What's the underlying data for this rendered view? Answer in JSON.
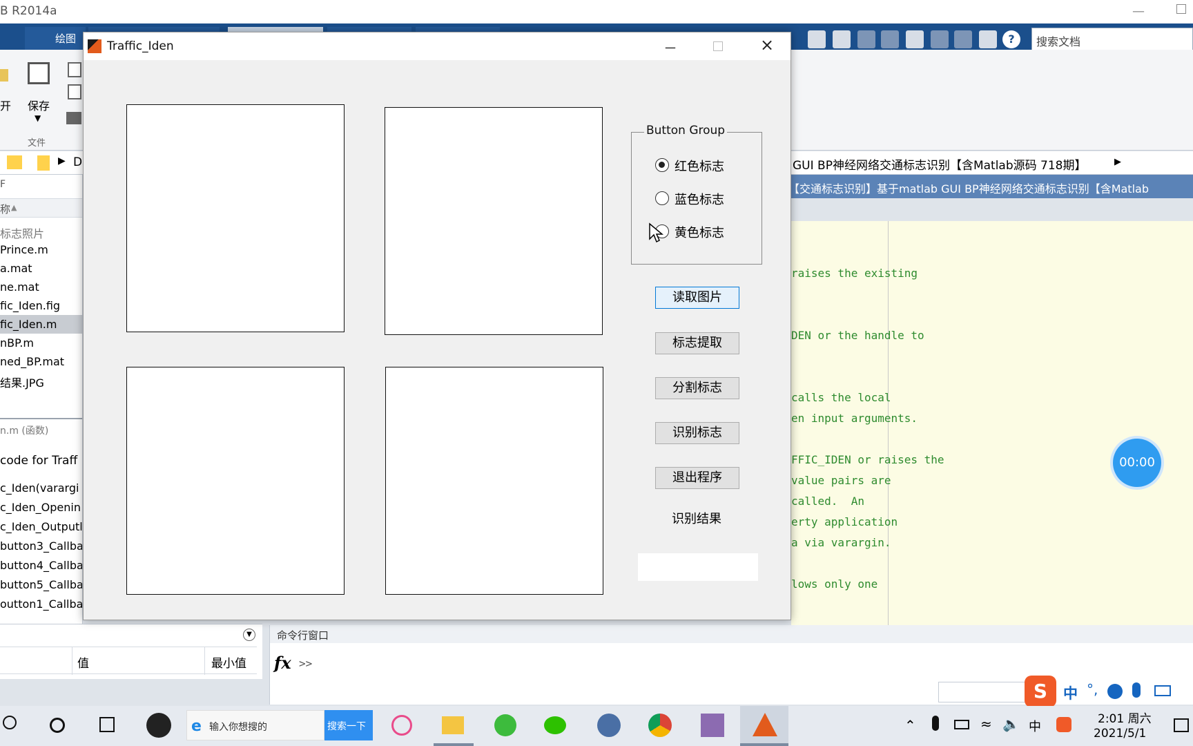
{
  "titlebar": {
    "title": "B R2014a"
  },
  "toolbar_tabs": {
    "plot_tab": "绘图"
  },
  "ribbon": {
    "open_label": "开",
    "save_label": "保存",
    "file_group": "文件"
  },
  "quick_access": {
    "search_placeholder": "搜索文档"
  },
  "path_bar": {
    "left_path": "D",
    "right_path": "GUI BP神经网络交通标志识别【含Matlab源码 718期】"
  },
  "editor_tab": {
    "label": "【交通标志识别】基于matlab GUI BP神经网络交通标志识别【含Matlab"
  },
  "file_browser": {
    "header_fragment": "F",
    "name_col": "称",
    "items": [
      "标志照片",
      "Prince.m",
      "a.mat",
      "ne.mat",
      "fic_Iden.fig",
      "fic_Iden.m",
      "nBP.m",
      "ned_BP.mat",
      "结果.JPG"
    ],
    "selected_index": 5,
    "details_title": "n.m (函数)",
    "details_items": [
      "code for Traff",
      "c_Iden(varargi",
      "c_Iden_Openin",
      "c_Iden_Outputl",
      "button3_Callba",
      "button4_Callba",
      "button5_Callba",
      "outton1_Callba"
    ]
  },
  "workspace": {
    "value_col": "值",
    "min_col": "最小值"
  },
  "editor_code": {
    "lines": [
      "raises the existing",
      "DEN or the handle to",
      "calls the local",
      "en input arguments.",
      "FFIC_IDEN or raises the",
      "value pairs are",
      "called.  An",
      "erty application",
      "a via varargin.",
      "lows only one"
    ]
  },
  "command_window": {
    "title": "命令行窗口",
    "fx": "fx",
    "prompt": ">>"
  },
  "timer": {
    "value": "00:00"
  },
  "figure": {
    "title": "Traffic_Iden",
    "button_group_title": "Button Group",
    "radios": [
      {
        "label": "红色标志",
        "selected": true
      },
      {
        "label": "蓝色标志",
        "selected": false
      },
      {
        "label": "黄色标志",
        "selected": false
      }
    ],
    "buttons": [
      "读取图片",
      "标志提取",
      "分割标志",
      "识别标志",
      "退出程序"
    ],
    "result_label": "识别结果",
    "result_value": ""
  },
  "ime": {
    "lang": "中",
    "punct": "°,"
  },
  "taskbar": {
    "search_placeholder": "输入你想搜的",
    "search_button": "搜索一下",
    "clock_time": "2:01 周六",
    "clock_date": "2021/5/1",
    "tray_lang": "中"
  },
  "colors": {
    "editor_bg": "#fcfce4",
    "code_green": "#2e8b2e",
    "taskbar_bg": "#e6eaf0",
    "timer_blue": "#2f9cf0",
    "accent": "#0078d7"
  }
}
